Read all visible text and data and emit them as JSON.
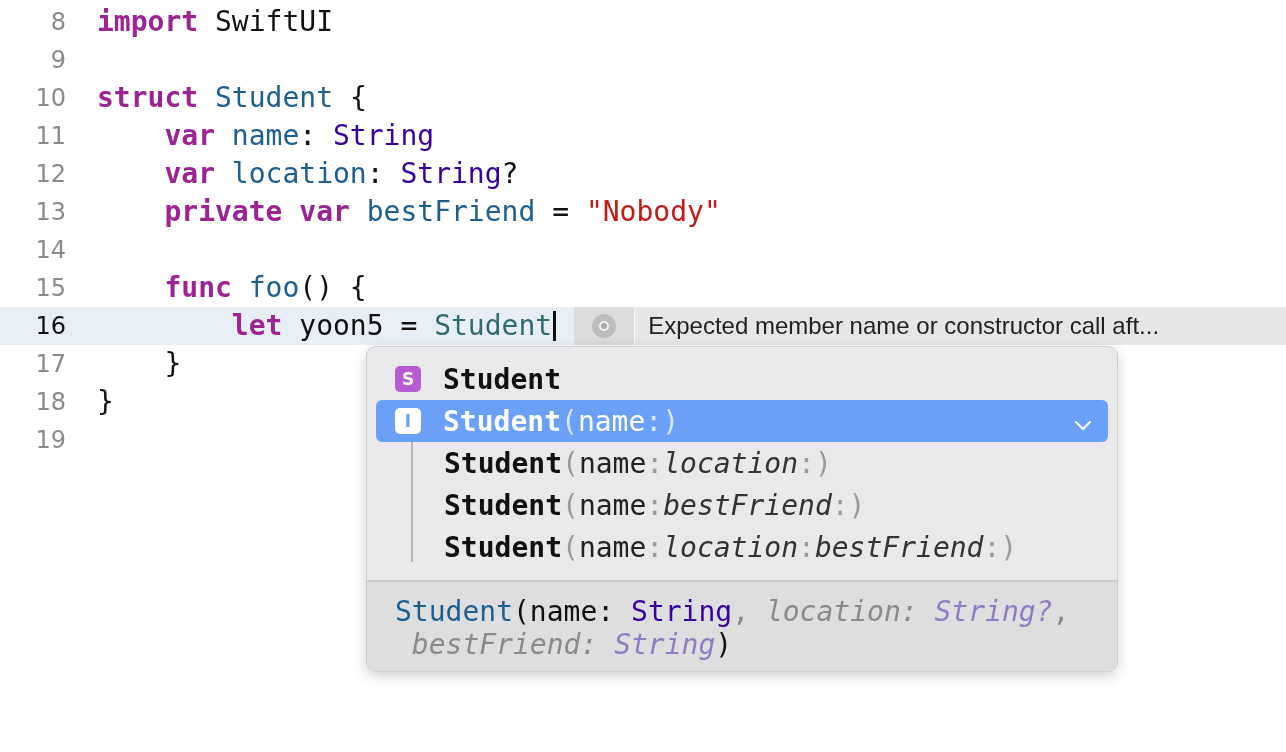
{
  "editor": {
    "lines": [
      {
        "number": "8",
        "current": false,
        "tokens": [
          {
            "kind": "keyword",
            "text": "import "
          },
          {
            "kind": "plain",
            "text": "SwiftUI"
          }
        ]
      },
      {
        "number": "9",
        "current": false
      },
      {
        "number": "10",
        "current": false,
        "tokens": [
          {
            "kind": "keyword",
            "text": "struct "
          },
          {
            "kind": "decl",
            "text": "Student"
          },
          {
            "kind": "plain",
            "text": " {"
          }
        ]
      },
      {
        "number": "11",
        "current": false,
        "tokens": [
          {
            "kind": "keyword",
            "text": "    var "
          },
          {
            "kind": "decl",
            "text": "name"
          },
          {
            "kind": "plain",
            "text": ": "
          },
          {
            "kind": "type",
            "text": "String"
          }
        ]
      },
      {
        "number": "12",
        "current": false,
        "tokens": [
          {
            "kind": "keyword",
            "text": "    var "
          },
          {
            "kind": "decl",
            "text": "location"
          },
          {
            "kind": "plain",
            "text": ": "
          },
          {
            "kind": "type",
            "text": "String"
          },
          {
            "kind": "plain",
            "text": "?"
          }
        ]
      },
      {
        "number": "13",
        "current": false,
        "tokens": [
          {
            "kind": "keyword",
            "text": "    private var "
          },
          {
            "kind": "decl",
            "text": "bestFriend"
          },
          {
            "kind": "plain",
            "text": " = "
          },
          {
            "kind": "string",
            "text": "\"Nobody\""
          }
        ]
      },
      {
        "number": "14",
        "current": false
      },
      {
        "number": "15",
        "current": false,
        "tokens": [
          {
            "kind": "keyword",
            "text": "    func "
          },
          {
            "kind": "decl",
            "text": "foo"
          },
          {
            "kind": "plain",
            "text": "() {"
          }
        ]
      },
      {
        "number": "16",
        "current": true,
        "tokens": [
          {
            "kind": "keyword",
            "text": "        let"
          },
          {
            "kind": "plain",
            "text": " yoon5 = "
          },
          {
            "kind": "typeref",
            "text": "Student"
          }
        ],
        "error": "Expected member name or constructor call aft..."
      },
      {
        "number": "17",
        "current": false,
        "tokens": [
          {
            "kind": "plain",
            "text": "    }"
          }
        ]
      },
      {
        "number": "18",
        "current": false,
        "tokens": [
          {
            "kind": "plain",
            "text": "}"
          }
        ]
      },
      {
        "number": "19",
        "current": false
      }
    ]
  },
  "completion": {
    "items": [
      {
        "badge": "S",
        "kind": "struct",
        "name": "Student",
        "selected": false
      },
      {
        "badge": "I",
        "kind": "init",
        "name": "Student",
        "selected": true,
        "expanded": true,
        "parts": [
          {
            "kind": "punct",
            "text": "("
          },
          {
            "kind": "label",
            "text": "name"
          },
          {
            "kind": "punct",
            "text": ":)"
          }
        ],
        "children": [
          {
            "name": "Student",
            "parts": [
              {
                "kind": "punct",
                "text": "("
              },
              {
                "kind": "label",
                "text": "name"
              },
              {
                "kind": "punct",
                "text": ":"
              },
              {
                "kind": "arg",
                "text": "location"
              },
              {
                "kind": "punct",
                "text": ":)"
              }
            ]
          },
          {
            "name": "Student",
            "parts": [
              {
                "kind": "punct",
                "text": "("
              },
              {
                "kind": "label",
                "text": "name"
              },
              {
                "kind": "punct",
                "text": ":"
              },
              {
                "kind": "arg",
                "text": "bestFriend"
              },
              {
                "kind": "punct",
                "text": ":)"
              }
            ]
          },
          {
            "name": "Student",
            "parts": [
              {
                "kind": "punct",
                "text": "("
              },
              {
                "kind": "label",
                "text": "name"
              },
              {
                "kind": "punct",
                "text": ":"
              },
              {
                "kind": "arg",
                "text": "location"
              },
              {
                "kind": "punct",
                "text": ":"
              },
              {
                "kind": "arg",
                "text": "bestFriend"
              },
              {
                "kind": "punct",
                "text": ":)"
              }
            ]
          }
        ]
      }
    ],
    "detail": {
      "lines": [
        [
          {
            "kind": "decl",
            "text": "Student"
          },
          {
            "kind": "plain",
            "text": "(name: "
          },
          {
            "kind": "type",
            "text": "String"
          },
          {
            "kind": "optpunct",
            "text": ", "
          },
          {
            "kind": "optlabel",
            "text": "location: "
          },
          {
            "kind": "opttype",
            "text": "String?"
          },
          {
            "kind": "optpunct",
            "text": ","
          }
        ],
        [
          {
            "kind": "optlabel",
            "text": " bestFriend: "
          },
          {
            "kind": "opttype",
            "text": "String"
          },
          {
            "kind": "plain",
            "text": ")"
          }
        ]
      ]
    }
  }
}
